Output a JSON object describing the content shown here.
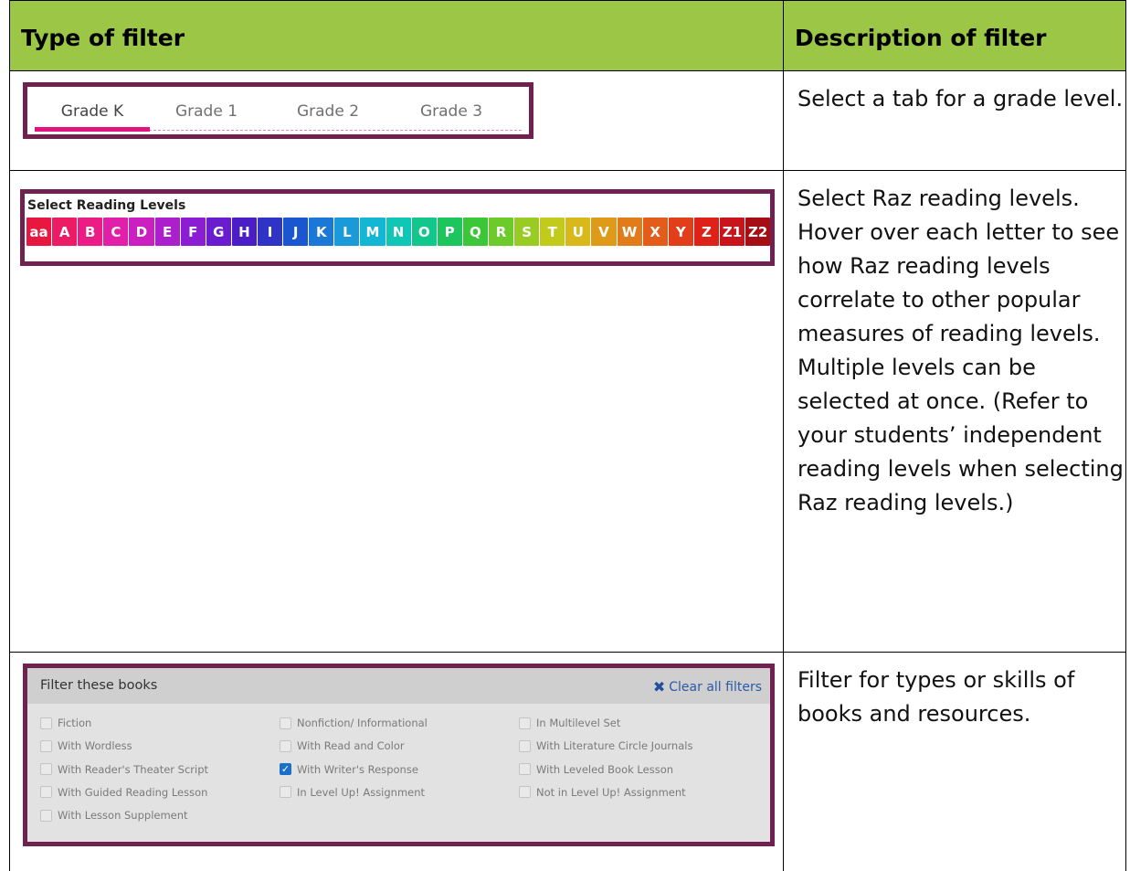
{
  "header": {
    "col1": "Type of filter",
    "col2": "Description of filter"
  },
  "rows": [
    {
      "description": "Select a tab for a grade level.",
      "tabs": [
        "Grade K",
        "Grade 1",
        "Grade 2",
        "Grade 3"
      ],
      "active_tab": "Grade K",
      "accent_color": "#e2147d"
    },
    {
      "description": "Select Raz reading levels. Hover over each letter to see how Raz reading levels correlate to other popular measures of reading levels. Multiple levels can be selected at once. (Refer to your students’ independent reading levels when selecting Raz reading levels.)",
      "label": "Select Reading Levels",
      "levels": [
        {
          "label": "aa",
          "color": "#e8173f"
        },
        {
          "label": "A",
          "color": "#ec1b63"
        },
        {
          "label": "B",
          "color": "#ec1c86"
        },
        {
          "label": "C",
          "color": "#e11fa8"
        },
        {
          "label": "D",
          "color": "#cc1fc1"
        },
        {
          "label": "E",
          "color": "#ac1fcd"
        },
        {
          "label": "F",
          "color": "#8b1dd2"
        },
        {
          "label": "G",
          "color": "#6a1ccf"
        },
        {
          "label": "H",
          "color": "#4a1dc7"
        },
        {
          "label": "I",
          "color": "#2f34c7"
        },
        {
          "label": "J",
          "color": "#1a56cf"
        },
        {
          "label": "K",
          "color": "#1b78d6"
        },
        {
          "label": "L",
          "color": "#1a9ad8"
        },
        {
          "label": "M",
          "color": "#14b7d3"
        },
        {
          "label": "N",
          "color": "#10c6b5"
        },
        {
          "label": "O",
          "color": "#12c78b"
        },
        {
          "label": "P",
          "color": "#1dc65c"
        },
        {
          "label": "Q",
          "color": "#3cc739"
        },
        {
          "label": "R",
          "color": "#6cca2b"
        },
        {
          "label": "S",
          "color": "#98cc24"
        },
        {
          "label": "T",
          "color": "#c2cb1c"
        },
        {
          "label": "U",
          "color": "#d8b81a"
        },
        {
          "label": "V",
          "color": "#df9a1a"
        },
        {
          "label": "W",
          "color": "#e27b1a"
        },
        {
          "label": "X",
          "color": "#e45c1a"
        },
        {
          "label": "Y",
          "color": "#e23e1a"
        },
        {
          "label": "Z",
          "color": "#df2218"
        },
        {
          "label": "Z1",
          "color": "#c8141a"
        },
        {
          "label": "Z2",
          "color": "#a60e14"
        }
      ]
    },
    {
      "description": "Filter for types or skills of books and resources.",
      "title": "Filter these books",
      "clear_label": "Clear all filters",
      "filters": [
        {
          "label": "Fiction",
          "checked": false
        },
        {
          "label": "With Wordless",
          "checked": false
        },
        {
          "label": "With Reader's Theater Script",
          "checked": false
        },
        {
          "label": "With Guided Reading Lesson",
          "checked": false
        },
        {
          "label": "With Lesson Supplement",
          "checked": false
        },
        {
          "label": "Nonfiction/ Informational",
          "checked": false
        },
        {
          "label": "With Read and Color",
          "checked": false
        },
        {
          "label": "With Writer's Response",
          "checked": true
        },
        {
          "label": "In Level Up! Assignment",
          "checked": false
        },
        {
          "label": "In Multilevel Set",
          "checked": false
        },
        {
          "label": "With Literature Circle Journals",
          "checked": false
        },
        {
          "label": "With Leveled Book Lesson",
          "checked": false
        },
        {
          "label": "Not in Level Up! Assignment",
          "checked": false
        }
      ]
    }
  ],
  "colors": {
    "header_bg": "#9bc646",
    "frame_border": "#6f2150",
    "checkbox_checked": "#1a6fc9"
  }
}
